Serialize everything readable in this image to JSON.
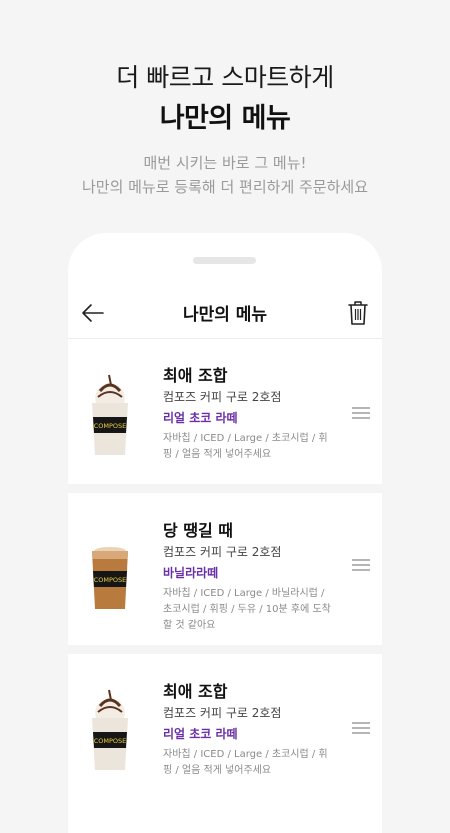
{
  "promo": {
    "headline_line1": "더 빠르고 스마트하게",
    "headline_line2": "나만의 메뉴",
    "desc_line1": "매번 시키는 바로 그 메뉴!",
    "desc_line2": "나만의 메뉴로 등록해 더 편리하게 주문하세요"
  },
  "header": {
    "title": "나만의 메뉴",
    "back_icon": "arrow-left-icon",
    "delete_icon": "trash-icon"
  },
  "accent_color": "#6a2fa6",
  "menu_items": [
    {
      "name": "최애 조합",
      "store": "컴포즈 커피 구로 2호점",
      "drink": "리얼 초코 라떼",
      "options": "자바칩 / ICED / Large / 초코시럽 / 휘핑 / 얼음 적게 넣어주세요",
      "image": "iced-chocolate-latte-cup",
      "cup_label": "COMPOSE"
    },
    {
      "name": "당 땡길 때",
      "store": "컴포즈 커피 구로 2호점",
      "drink": "바닐라라떼",
      "options": "자바칩 / ICED / Large / 바닐라시럽 / 초코시럽 / 휘핑 / 두유 / 10분 후에 도착할 것 같아요",
      "image": "iced-vanilla-latte-cup",
      "cup_label": "COMPOSE"
    },
    {
      "name": "최애 조합",
      "store": "컴포즈 커피 구로 2호점",
      "drink": "리얼 초코 라떼",
      "options": "자바칩 / ICED / Large / 초코시럽 / 휘핑 / 얼음 적게 넣어주세요",
      "image": "iced-chocolate-latte-cup",
      "cup_label": "COMPOSE"
    }
  ]
}
